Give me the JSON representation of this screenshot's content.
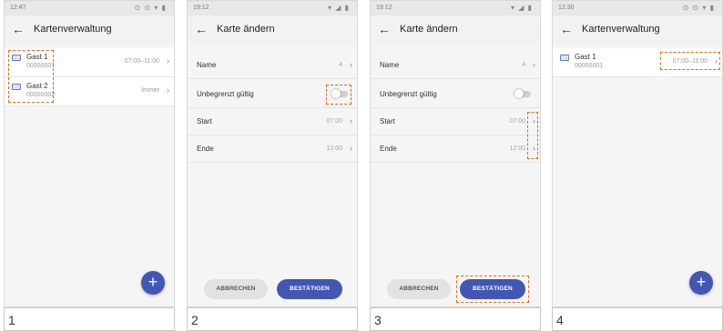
{
  "colors": {
    "accent": "#4257b2",
    "highlight": "#e06a1d"
  },
  "panels": [
    {
      "caption": "1",
      "status_time": "12:47",
      "status_icons": "⊙ ⊙ ▾ ▮",
      "title": "Kartenverwaltung",
      "rows": [
        {
          "name": "Gast 1",
          "number": "00000001",
          "value": "07:00–11:00"
        },
        {
          "name": "Gast 2",
          "number": "00000002",
          "value": "Immer"
        }
      ],
      "fab": "+"
    },
    {
      "caption": "2",
      "status_time": "19:12",
      "status_icons": "▾ ◢ ▮",
      "title": "Karte ändern",
      "fields": [
        {
          "label": "Name",
          "value": "4"
        },
        {
          "label": "Unbegrenzt gültig",
          "value": ""
        },
        {
          "label": "Start",
          "value": "07:00"
        },
        {
          "label": "Ende",
          "value": "12:00"
        }
      ],
      "cancel": "ABBRECHEN",
      "confirm": "BESTÄTIGEN"
    },
    {
      "caption": "3",
      "status_time": "19:12",
      "status_icons": "▾ ◢ ▮",
      "title": "Karte ändern",
      "fields": [
        {
          "label": "Name",
          "value": "4"
        },
        {
          "label": "Unbegrenzt gültig",
          "value": ""
        },
        {
          "label": "Start",
          "value": "07:00"
        },
        {
          "label": "Ende",
          "value": "12:00"
        }
      ],
      "cancel": "ABBRECHEN",
      "confirm": "BESTÄTIGEN"
    },
    {
      "caption": "4",
      "status_time": "12:30",
      "status_icons": "⊙ ⊙ ▾ ▮",
      "title": "Kartenverwaltung",
      "rows": [
        {
          "name": "Gast 1",
          "number": "00000001",
          "value": "07:00–11:00"
        }
      ],
      "fab": "+"
    }
  ]
}
